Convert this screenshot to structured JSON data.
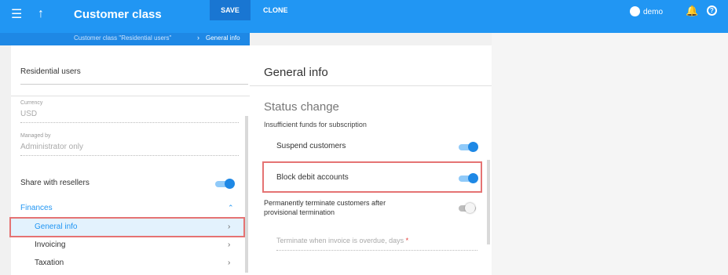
{
  "header": {
    "title": "Customer class",
    "save_label": "SAVE",
    "clone_label": "CLONE",
    "user_name": "demo"
  },
  "breadcrumb": {
    "parent": "Customer class \"Residential users\"",
    "current": "General info"
  },
  "left_panel": {
    "name_value": "Residential users",
    "currency_label": "Currency",
    "currency_value": "USD",
    "managed_by_label": "Managed by",
    "managed_by_value": "Administrator only",
    "share_label": "Share with resellers",
    "share_enabled": true,
    "section": "Finances",
    "nav_items": [
      {
        "label": "General info",
        "active": true
      },
      {
        "label": "Invoicing",
        "active": false
      },
      {
        "label": "Taxation",
        "active": false
      }
    ]
  },
  "main": {
    "heading": "General info",
    "subheading": "Status change",
    "group_label": "Insufficient funds for subscription",
    "rows": [
      {
        "label": "Suspend customers",
        "enabled": true
      },
      {
        "label": "Block debit accounts",
        "enabled": true
      },
      {
        "label_line1": "Permanently terminate customers after",
        "label_line2": "provisional termination",
        "enabled": false
      }
    ],
    "terminate_placeholder": "Terminate when invoice is overdue, days",
    "required_mark": "*"
  },
  "colors": {
    "accent": "#2196f3",
    "highlight": "#e57373"
  }
}
